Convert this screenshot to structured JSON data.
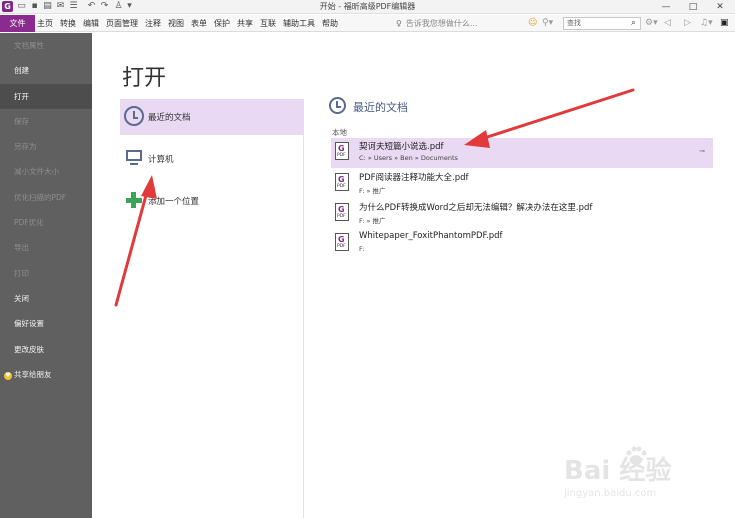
{
  "window": {
    "title": "开始 - 福昕高级PDF编辑器",
    "app_logo_letter": "G",
    "controls": [
      "—",
      "□",
      "✕"
    ]
  },
  "quick_access": [
    "open-icon",
    "save-icon",
    "print-icon",
    "email-icon",
    "hand-icon",
    "undo-icon",
    "redo-icon",
    "stamp-icon",
    "dropdown-icon"
  ],
  "menu": {
    "file_label": "文件",
    "items": [
      "主页",
      "转换",
      "编辑",
      "页面管理",
      "注释",
      "视图",
      "表单",
      "保护",
      "共享",
      "互联",
      "辅助工具",
      "帮助"
    ],
    "tell_me_placeholder": "告诉我您想做什么...",
    "search_placeholder": "查找"
  },
  "sidebar": {
    "items": [
      {
        "label": "文档属性",
        "state": "disabled"
      },
      {
        "label": "创建",
        "state": "enabled"
      },
      {
        "label": "打开",
        "state": "active"
      },
      {
        "label": "保存",
        "state": "disabled"
      },
      {
        "label": "另存为",
        "state": "disabled"
      },
      {
        "label": "减小文件大小",
        "state": "disabled"
      },
      {
        "label": "优化扫描的PDF",
        "state": "disabled"
      },
      {
        "label": "PDF优化",
        "state": "disabled"
      },
      {
        "label": "导出",
        "state": "disabled"
      },
      {
        "label": "打印",
        "state": "disabled"
      },
      {
        "label": "关闭",
        "state": "enabled"
      },
      {
        "label": "偏好设置",
        "state": "enabled"
      },
      {
        "label": "更改皮肤",
        "state": "enabled"
      },
      {
        "label": "共享给朋友",
        "state": "enabled"
      }
    ]
  },
  "main": {
    "title": "打开",
    "locations": [
      {
        "label": "最近的文档",
        "icon": "clock-icon"
      },
      {
        "label": "计算机",
        "icon": "computer-icon"
      },
      {
        "label": "添加一个位置",
        "icon": "plus-icon"
      }
    ],
    "recent": {
      "title": "最近的文档",
      "group_label": "本地",
      "files": [
        {
          "name": "契诃夫短篇小说选.pdf",
          "path": "C: » Users » Ben » Documents"
        },
        {
          "name": "PDF阅读器注释功能大全.pdf",
          "path": "F: » 推广"
        },
        {
          "name": "为什么PDF转换成Word之后却无法编辑？解决办法在这里.pdf",
          "path": "F: » 推广"
        },
        {
          "name": "Whitepaper_FoxitPhantomPDF.pdf",
          "path": "F:"
        }
      ]
    }
  },
  "file_icon_text": {
    "glyph": "G",
    "tag": "PDF"
  },
  "watermark": {
    "main": "Bai  经验",
    "sub": "jingyan.baidu.com"
  },
  "colors": {
    "brand": "#8b2a8f",
    "selection": "#e9d9f2",
    "sidebar": "#606060",
    "arrow": "#e23a3a",
    "icon_blue": "#5a6a92"
  }
}
